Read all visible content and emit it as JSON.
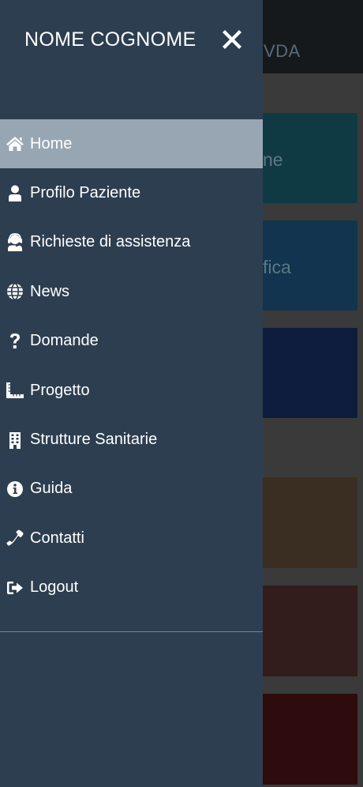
{
  "drawer": {
    "user_name": "NOME COGNOME",
    "close_icon": "close-icon",
    "active_item": "home",
    "items": [
      {
        "id": "home",
        "label": "Home",
        "icon": "home-icon"
      },
      {
        "id": "profilo-paziente",
        "label": "Profilo Paziente",
        "icon": "user-icon"
      },
      {
        "id": "richieste-assistenza",
        "label": "Richieste di assistenza",
        "icon": "support-agent-icon"
      },
      {
        "id": "news",
        "label": "News",
        "icon": "globe-icon"
      },
      {
        "id": "domande",
        "label": "Domande",
        "icon": "question-icon"
      },
      {
        "id": "progetto",
        "label": "Progetto",
        "icon": "ruler-icon"
      },
      {
        "id": "strutture-sanitarie",
        "label": "Strutture Sanitarie",
        "icon": "building-icon"
      },
      {
        "id": "guida",
        "label": "Guida",
        "icon": "info-icon"
      },
      {
        "id": "contatti",
        "label": "Contatti",
        "icon": "phone-icon"
      },
      {
        "id": "logout",
        "label": "Logout",
        "icon": "logout-icon"
      }
    ]
  },
  "background": {
    "header_title_fragment": "VDA",
    "cards": [
      {
        "label_fragment": "ne",
        "color": "#0f3a44"
      },
      {
        "label_fragment": "fica",
        "color": "#12344e"
      },
      {
        "label_fragment": "",
        "color": "#0e1c3e"
      },
      {
        "label_fragment": "",
        "color": "#3a2e22"
      },
      {
        "label_fragment": "",
        "color": "#331c1c"
      },
      {
        "label_fragment": "",
        "color": "#2e0b0d"
      }
    ]
  },
  "colors": {
    "drawer_bg": "#2d3e50",
    "active_item_bg": "#98a6b4",
    "text": "#ffffff",
    "overlay_bg": "#3a3a3a"
  }
}
